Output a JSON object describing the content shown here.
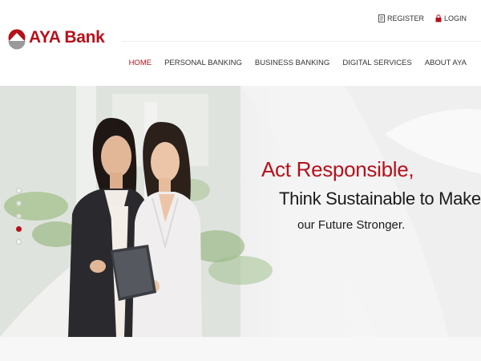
{
  "brand": {
    "name": "AYA Bank",
    "color": "#b5121b"
  },
  "utility": {
    "register_label": "REGISTER",
    "register_icon": "register-icon",
    "login_label": "LOGIN",
    "login_icon": "lock-icon"
  },
  "nav": {
    "items": [
      {
        "label": "HOME",
        "active": true
      },
      {
        "label": "PERSONAL BANKING",
        "active": false
      },
      {
        "label": "BUSINESS BANKING",
        "active": false
      },
      {
        "label": "DIGITAL SERVICES",
        "active": false
      },
      {
        "label": "ABOUT AYA",
        "active": false
      }
    ]
  },
  "hero": {
    "line1": "Act Responsible,",
    "line2": "Think Sustainable to Make",
    "line3": "our Future Stronger.",
    "slides_count": 5,
    "active_slide": 4
  }
}
